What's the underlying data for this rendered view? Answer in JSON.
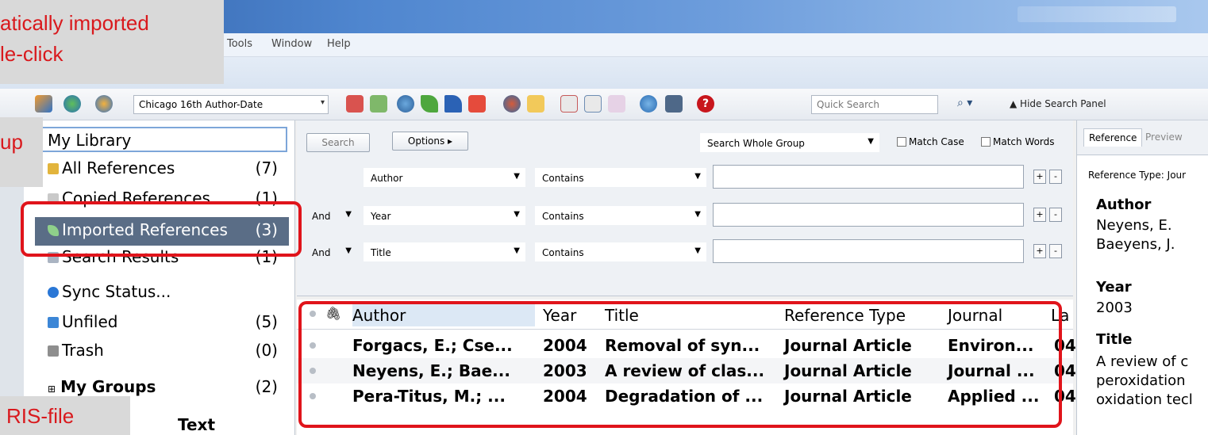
{
  "window": {
    "menu": [
      "Tools",
      "Window",
      "Help"
    ]
  },
  "toolbar": {
    "style": "Chicago 16th Author-Date",
    "quick_search_placeholder": "Quick Search",
    "hide_panel": "Hide Search Panel"
  },
  "library": {
    "header": "My Library",
    "items": [
      {
        "label": "All References",
        "count": "(7)",
        "icon": "references-icon"
      },
      {
        "label": "Copied References",
        "count": "(1)",
        "icon": "copy-icon"
      },
      {
        "label": "Imported References",
        "count": "(3)",
        "icon": "import-icon"
      },
      {
        "label": "Search Results",
        "count": "(1)",
        "icon": "search-results-icon"
      },
      {
        "label": "Sync Status...",
        "count": "",
        "icon": "info-icon"
      },
      {
        "label": "Unfiled",
        "count": "(5)",
        "icon": "folder-icon"
      },
      {
        "label": "Trash",
        "count": "(0)",
        "icon": "trash-icon"
      },
      {
        "label": "My Groups",
        "count": "(2)",
        "icon": "expand-icon"
      },
      {
        "label": "Text",
        "count": "",
        "icon": ""
      }
    ]
  },
  "search": {
    "search_label": "Search",
    "options_label": "Options ▸",
    "scope": "Search Whole Group",
    "match_case": "Match Case",
    "match_words": "Match Words",
    "rows": [
      {
        "bool": "",
        "field": "Author",
        "op": "Contains"
      },
      {
        "bool": "And",
        "field": "Year",
        "op": "Contains"
      },
      {
        "bool": "And",
        "field": "Title",
        "op": "Contains"
      }
    ]
  },
  "table": {
    "headers": [
      "Author",
      "Year",
      "Title",
      "Reference Type",
      "Journal",
      "La"
    ],
    "rows": [
      [
        "Forgacs, E.; Cse...",
        "2004",
        "Removal of syn...",
        "Journal Article",
        "Environ...",
        "04"
      ],
      [
        "Neyens, E.; Bae...",
        "2003",
        "A review of clas...",
        "Journal Article",
        "Journal ...",
        "04"
      ],
      [
        "Pera-Titus, M.; ...",
        "2004",
        "Degradation of ...",
        "Journal Article",
        "Applied ...",
        "04"
      ]
    ]
  },
  "detail": {
    "tabs": [
      "Reference",
      "Preview"
    ],
    "type_label": "Reference Type: Jour",
    "author_heading": "Author",
    "authors": [
      "Neyens, E.",
      "Baeyens, J."
    ],
    "year_heading": "Year",
    "year": "2003",
    "title_heading": "Title",
    "title_lines": [
      "A review of c",
      "peroxidation",
      "oxidation tecl"
    ]
  },
  "callouts": {
    "top_lines": [
      "atically imported",
      "le-click"
    ],
    "group": "up",
    "ris": "RIS-file"
  },
  "colors": {
    "accent_red": "#e0141b",
    "selected_item": "#5a6d86",
    "callout_text": "#d9191d"
  }
}
